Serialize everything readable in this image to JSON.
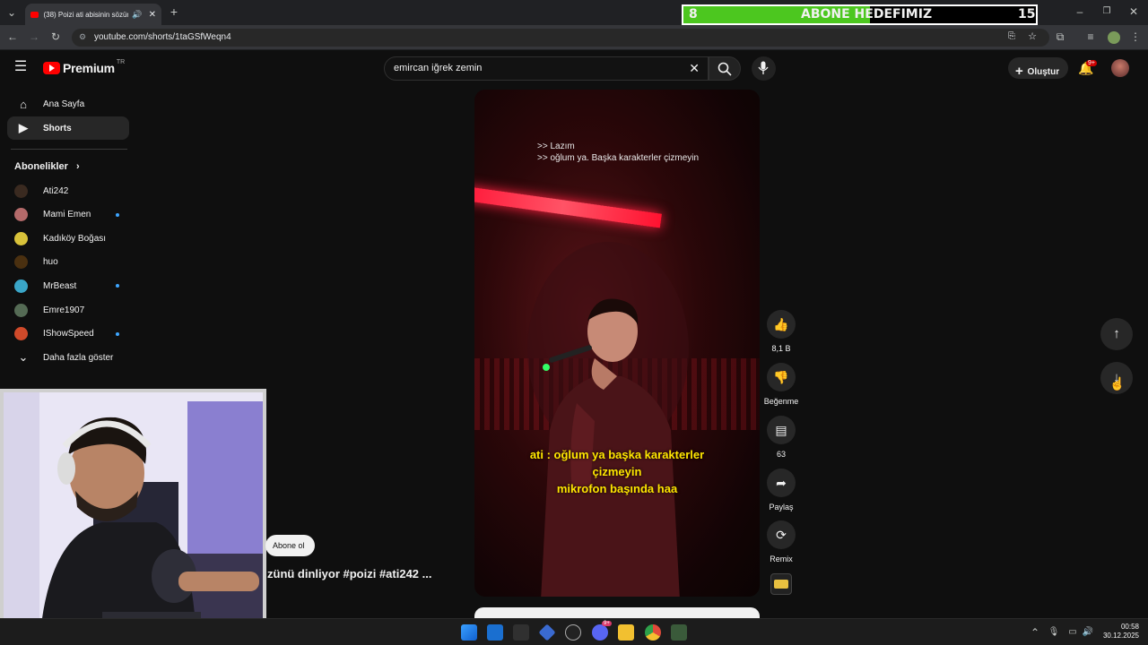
{
  "browser": {
    "tab_title": "(38) Poizi ati abisinin sözün",
    "url": "youtube.com/shorts/1taGSfWeqn4"
  },
  "goal_overlay": {
    "current": "8",
    "label": "ABONE HEDEFIMIZ",
    "target": "15",
    "progress": 0.53,
    "fill_color": "#4cc71f"
  },
  "header": {
    "logo_text": "Premium",
    "region": "TR",
    "search_value": "emircan iğrek zemin",
    "create_label": "Oluştur",
    "notification_count": "9+"
  },
  "sidebar": {
    "nav": [
      {
        "label": "Ana Sayfa",
        "icon": "home-icon"
      },
      {
        "label": "Shorts",
        "icon": "shorts-icon"
      }
    ],
    "subscriptions_title": "Abonelikler",
    "subscriptions": [
      {
        "label": "Ati242",
        "color": "#3a2a20",
        "new": false
      },
      {
        "label": "Mami Emen",
        "color": "#b46a6a",
        "new": true
      },
      {
        "label": "Kadıköy Boğası",
        "color": "#d8c23a",
        "new": false
      },
      {
        "label": "huo",
        "color": "#4a3010",
        "new": false
      },
      {
        "label": "MrBeast",
        "color": "#3aa6c8",
        "new": true
      },
      {
        "label": "Emre1907",
        "color": "#556b55",
        "new": false
      },
      {
        "label": "IShowSpeed",
        "color": "#d04a2a",
        "new": true
      }
    ],
    "show_more": "Daha fazla göster"
  },
  "video": {
    "overlay_line1": ">> Lazım",
    "overlay_line2": ">> oğlum ya. Başka karakterler çizmeyin",
    "caption_line1": "ati : oğlum ya başka karakterler",
    "caption_line2": "çizmeyin",
    "caption_line3": "mikrofon başında haa",
    "title_fragment": "zünü dinliyor #poizi #ati242 ...",
    "subscribe_label": "Abone ol"
  },
  "actions": {
    "like_count": "8,1 B",
    "dislike_label": "Beğenme",
    "comment_count": "63",
    "share_label": "Paylaş",
    "remix_label": "Remix"
  },
  "taskbar": {
    "time": "00:58",
    "date": "30.12.2025",
    "teams_badge": "9+"
  }
}
